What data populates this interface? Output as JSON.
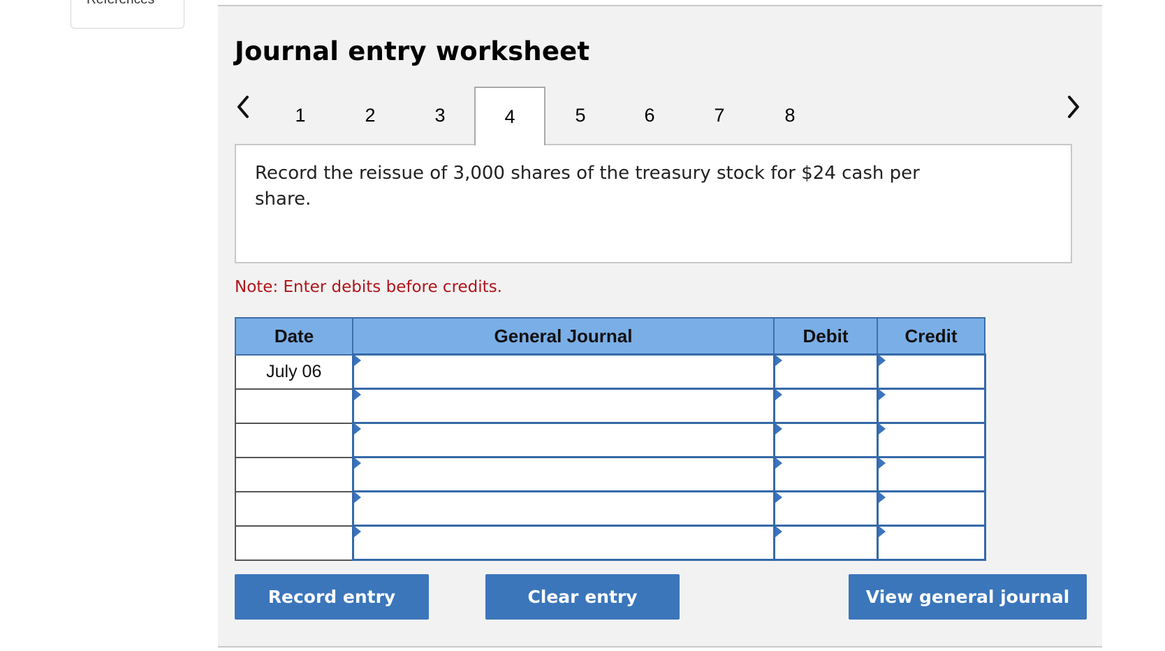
{
  "references_tab": {
    "label": "References"
  },
  "worksheet": {
    "title": "Journal entry worksheet",
    "tabs": [
      "1",
      "2",
      "3",
      "4",
      "5",
      "6",
      "7",
      "8"
    ],
    "active_tab": "4",
    "description": "Record the reissue of 3,000 shares of the treasury stock for $24 cash per share.",
    "note": "Note: Enter debits before credits."
  },
  "journal_table": {
    "headers": {
      "date": "Date",
      "general_journal": "General Journal",
      "debit": "Debit",
      "credit": "Credit"
    },
    "rows": [
      {
        "date": "July 06",
        "account": "",
        "debit": "",
        "credit": ""
      },
      {
        "date": "",
        "account": "",
        "debit": "",
        "credit": ""
      },
      {
        "date": "",
        "account": "",
        "debit": "",
        "credit": ""
      },
      {
        "date": "",
        "account": "",
        "debit": "",
        "credit": ""
      },
      {
        "date": "",
        "account": "",
        "debit": "",
        "credit": ""
      },
      {
        "date": "",
        "account": "",
        "debit": "",
        "credit": ""
      }
    ]
  },
  "buttons": {
    "record": "Record entry",
    "clear": "Clear entry",
    "view": "View general journal"
  },
  "colors": {
    "header_blue": "#7aaee6",
    "button_blue": "#3b76bb",
    "note_red": "#b0151a"
  }
}
